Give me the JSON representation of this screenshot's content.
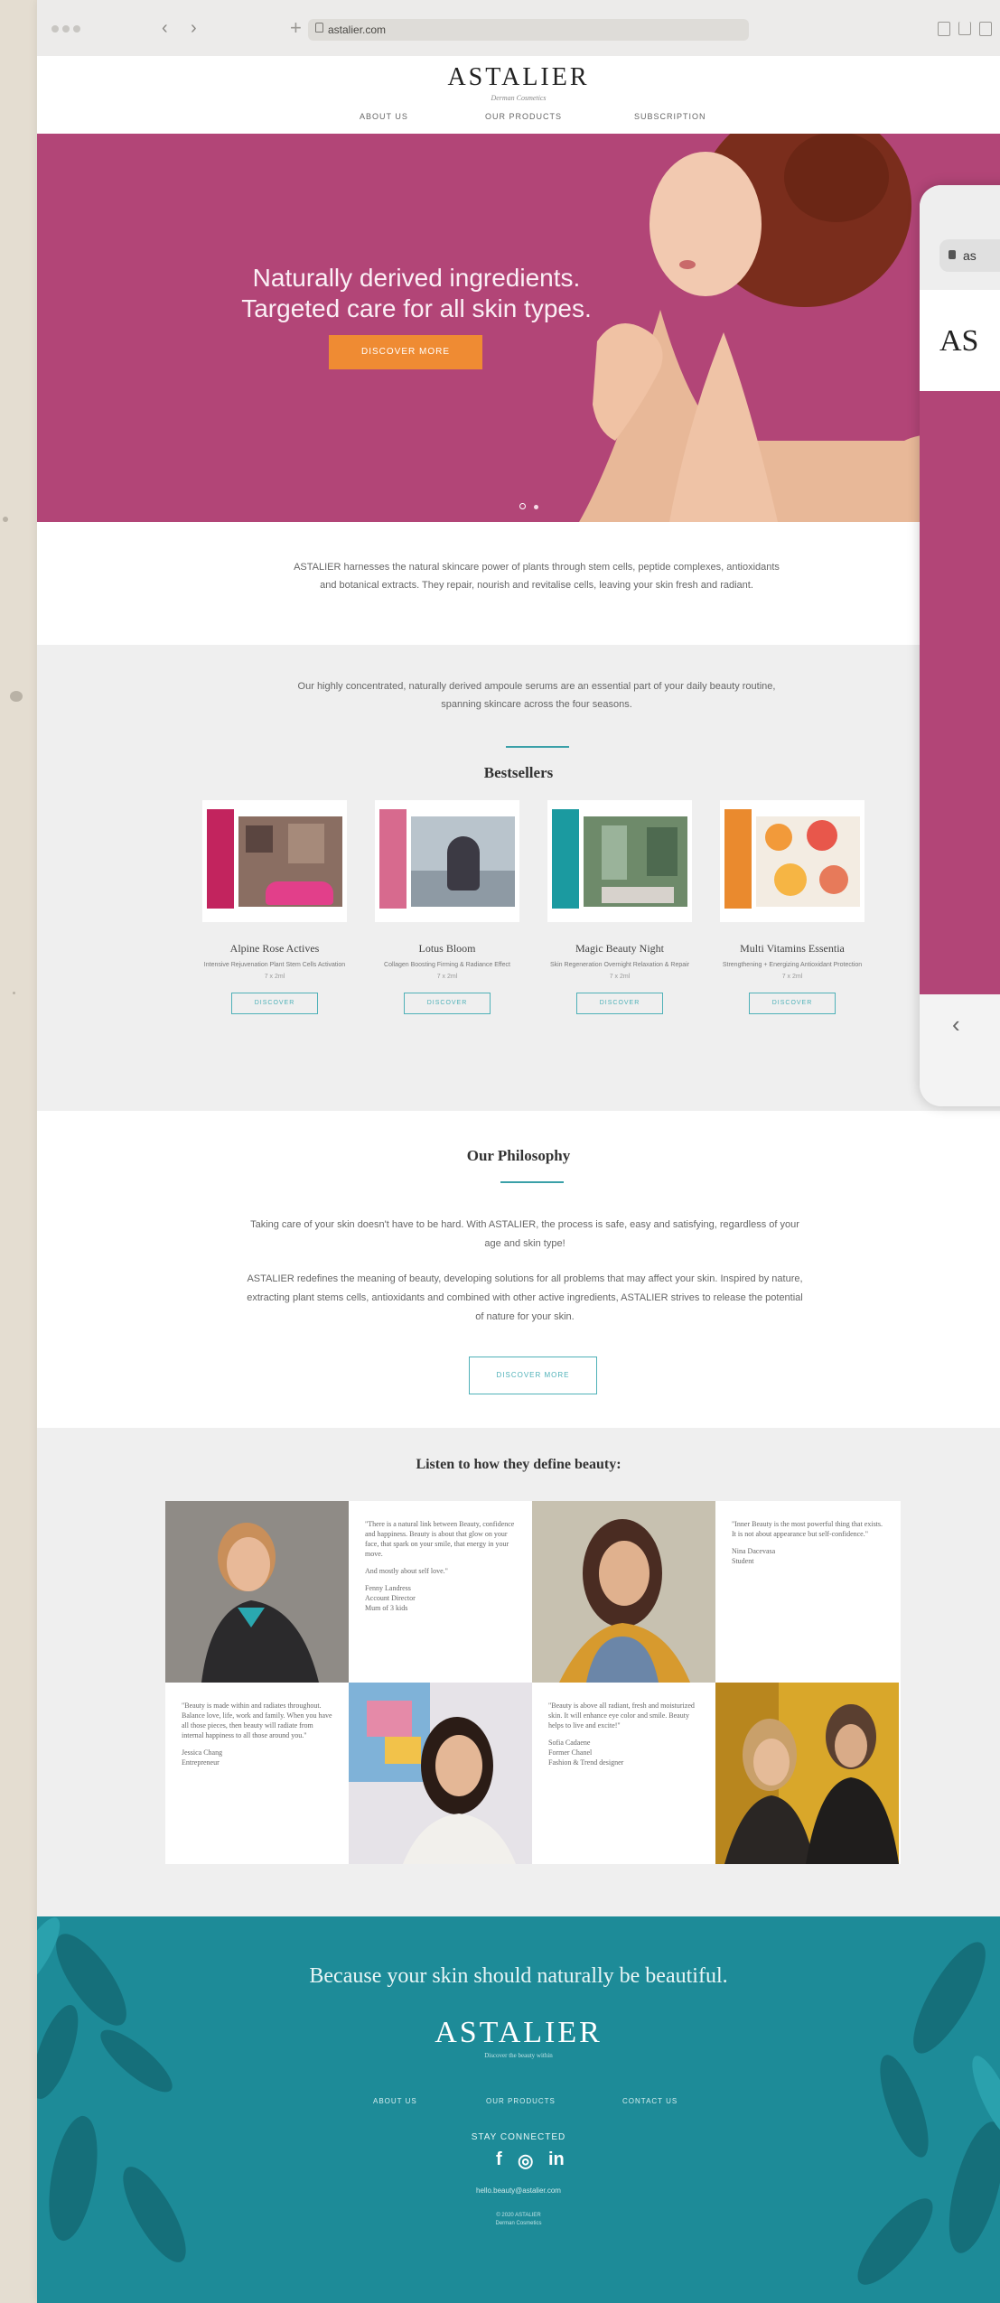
{
  "browser": {
    "url": "astalier.com"
  },
  "header": {
    "logo": "ASTALIER",
    "logo_sub": "Derman Cosmetics",
    "nav": [
      "ABOUT US",
      "OUR PRODUCTS",
      "SUBSCRIPTION"
    ]
  },
  "hero": {
    "title_line1": "Naturally derived ingredients.",
    "title_line2": "Targeted care for all skin types.",
    "button": "DISCOVER MORE"
  },
  "intro": {
    "text": "ASTALIER harnesses the natural skincare power of plants through stem cells, peptide complexes, antioxidants and botanical extracts. They repair, nourish and revitalise cells, leaving your skin fresh and radiant."
  },
  "bestsellers": {
    "lead": "Our highly concentrated, naturally derived ampoule serums are an essential part of your daily beauty routine, spanning skincare across the four seasons.",
    "title": "Bestsellers",
    "products": [
      {
        "name": "Alpine Rose Actives",
        "desc": "Intensive Rejuvenation Plant Stem Cells Activation",
        "volume": "7 x 2ml",
        "button": "DISCOVER",
        "box_color": "#c2245e"
      },
      {
        "name": "Lotus Bloom",
        "desc": "Collagen Boosting Firming & Radiance Effect",
        "volume": "7 x 2ml",
        "button": "DISCOVER",
        "box_color": "#d76a8e"
      },
      {
        "name": "Magic Beauty Night",
        "desc": "Skin Regeneration Overnight Relaxation & Repair",
        "volume": "7 x 2ml",
        "button": "DISCOVER",
        "box_color": "#1b9aa0"
      },
      {
        "name": "Multi Vitamins Essentia",
        "desc": "Strengthening + Energizing Antioxidant Protection",
        "volume": "7 x 2ml",
        "button": "DISCOVER",
        "box_color": "#ea8a2e"
      }
    ]
  },
  "philosophy": {
    "title": "Our Philosophy",
    "para1": "Taking care of your skin doesn't have to be hard. With ASTALIER, the process is safe, easy and satisfying, regardless of your age and skin type!",
    "para2": "ASTALIER redefines the meaning of beauty, developing solutions for all problems that may affect your skin. Inspired by nature, extracting plant stems cells, antioxidants and combined with other active ingredients, ASTALIER strives to release the potential of nature for your skin.",
    "button": "DISCOVER MORE"
  },
  "testimonials": {
    "title": "Listen to how they define beauty:",
    "quotes": [
      {
        "text": "\"There is a natural link between Beauty, confidence and happiness. Beauty is about that glow on your face, that spark on your smile, that energy in your move.",
        "text2": "And mostly about self love.\"",
        "author": "Fenny Landress",
        "role": "Account Director",
        "role2": "Mum of 3 kids"
      },
      {
        "text": "\"Inner Beauty is the most powerful thing that exists. It is not about appearance but self-confidence.\"",
        "author": "Nina Dacevasa",
        "role": "Student"
      },
      {
        "text": "\"Beauty is made within and radiates throughout. Balance love, life, work and family. When you have all those pieces, then beauty will radiate from internal happiness to all those around you.\"",
        "author": "Jessica Chang",
        "role": "Entrepreneur"
      },
      {
        "text": "\"Beauty is above all radiant, fresh and moisturized skin. It will enhance eye color and smile. Beauty helps to live and excite!\"",
        "author": "Sofia Cadaene",
        "role": "Former Chanel",
        "role2": "Fashion & Trend designer"
      }
    ]
  },
  "footer": {
    "tagline": "Because your skin should naturally be beautiful.",
    "logo": "ASTALIER",
    "logo_sub": "Discover the beauty within",
    "links": [
      "ABOUT US",
      "OUR PRODUCTS",
      "CONTACT US"
    ],
    "stay_connected": "STAY CONNECTED",
    "social": {
      "facebook": "f",
      "instagram": "◎",
      "linkedin": "in"
    },
    "email": "hello.beauty@astalier.com",
    "copyright": "© 2020 ASTALIER",
    "copyright2": "Derman Cosmetics"
  },
  "second_window": {
    "url_fragment": "as",
    "logo_fragment": "AS"
  },
  "colors": {
    "hero_bg": "#b24577",
    "accent_orange": "#ef8b33",
    "teal": "#1d8b98",
    "teal_line": "#3aa0a8"
  }
}
